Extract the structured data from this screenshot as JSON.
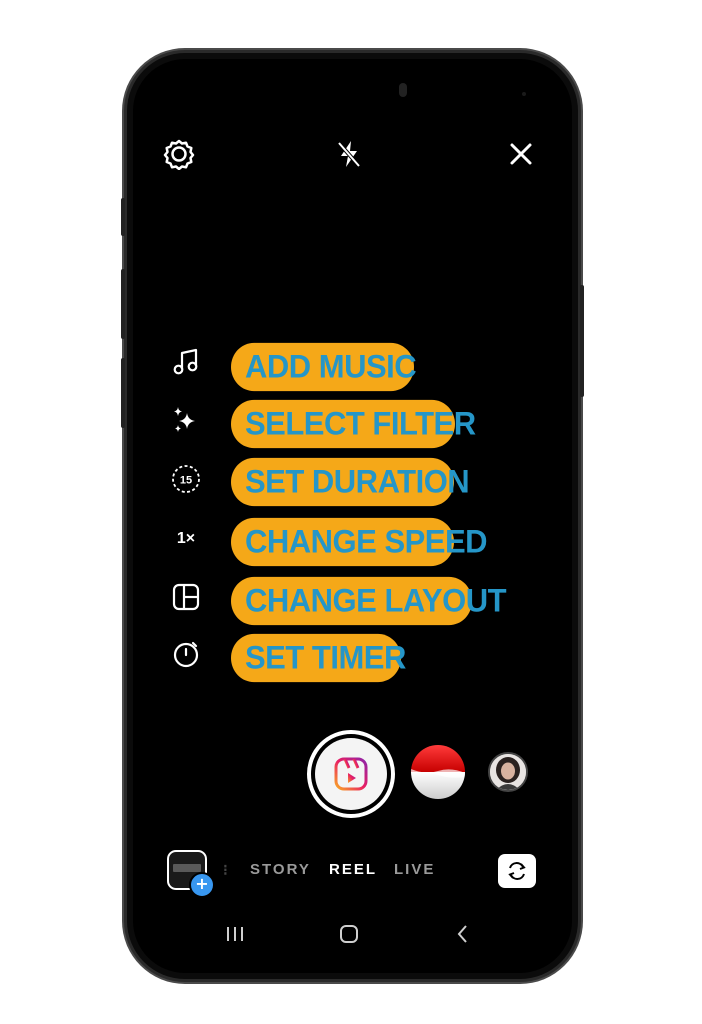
{
  "top_bar": {
    "settings_icon": "gear-icon",
    "flash_icon": "flash-off-icon",
    "close_icon": "close-icon"
  },
  "tools": [
    {
      "icon": "music-note-icon",
      "label": "ADD MUSIC"
    },
    {
      "icon": "sparkles-icon",
      "label": "SELECT FILTER"
    },
    {
      "icon": "duration-icon",
      "duration_value": "15",
      "label": "SET DURATION"
    },
    {
      "icon": "speed-icon",
      "speed_value": "1×",
      "label": "CHANGE SPEED"
    },
    {
      "icon": "layout-icon",
      "label": "CHANGE LAYOUT"
    },
    {
      "icon": "timer-icon",
      "label": "SET TIMER"
    }
  ],
  "capture": {
    "shutter_icon": "reels-icon",
    "effects": [
      "flag-effect",
      "profile-effect"
    ]
  },
  "modes": {
    "items": [
      "STORY",
      "REEL",
      "LIVE"
    ],
    "selected": "REEL"
  },
  "bottom": {
    "gallery_thumb_icon": "gallery-thumbnail",
    "gallery_add": "+",
    "flip_camera_icon": "flip-camera-icon"
  },
  "system_nav": [
    "recents-icon",
    "home-icon",
    "back-icon"
  ],
  "colors": {
    "pill_bg": "#f5a818",
    "pill_text": "#2596c8",
    "screen_bg": "#000000",
    "accent_blue": "#3897f0"
  }
}
